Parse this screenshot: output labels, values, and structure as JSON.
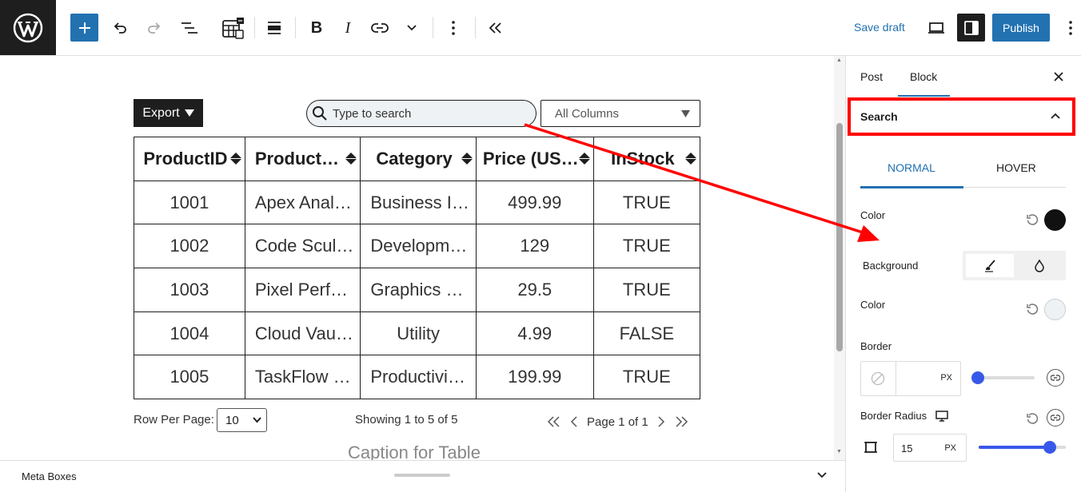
{
  "toolbar": {
    "save_draft": "Save draft",
    "publish": "Publish"
  },
  "table_block": {
    "export_label": "Export",
    "search_placeholder": "Type to search",
    "column_filter": "All Columns",
    "headers": [
      "ProductID",
      "Product…",
      "Category",
      "Price (US…",
      "InStock"
    ],
    "rows": [
      [
        "1001",
        "Apex Anal…",
        "Business I…",
        "499.99",
        "TRUE"
      ],
      [
        "1002",
        "Code Scul…",
        "Developm…",
        "129",
        "TRUE"
      ],
      [
        "1003",
        "Pixel Perf…",
        "Graphics …",
        "29.5",
        "TRUE"
      ],
      [
        "1004",
        "Cloud Vau…",
        "Utility",
        "4.99",
        "FALSE"
      ],
      [
        "1005",
        "TaskFlow …",
        "Productivi…",
        "199.99",
        "TRUE"
      ]
    ],
    "rows_per_page_label": "Row Per Page:",
    "rows_per_page_value": "10",
    "showing": "Showing 1 to 5 of 5",
    "page_label": "Page 1 of 1",
    "caption": "Caption for Table"
  },
  "meta_boxes": {
    "label": "Meta Boxes"
  },
  "sidebar": {
    "tabs": [
      "Post",
      "Block"
    ],
    "active_tab": "Block",
    "panel_title": "Search",
    "state_tabs": [
      "NORMAL",
      "HOVER"
    ],
    "color_label": "Color",
    "background_label": "Background",
    "bg_color_label": "Color",
    "border_label": "Border",
    "border_unit": "PX",
    "border_radius_label": "Border Radius",
    "border_radius_value": "15",
    "border_radius_unit": "PX",
    "text_color": "#111111",
    "background_color": "#eef2f4"
  },
  "colors": {
    "accent": "#2271b1",
    "slider": "#3858e9",
    "highlight": "#ff0000"
  }
}
